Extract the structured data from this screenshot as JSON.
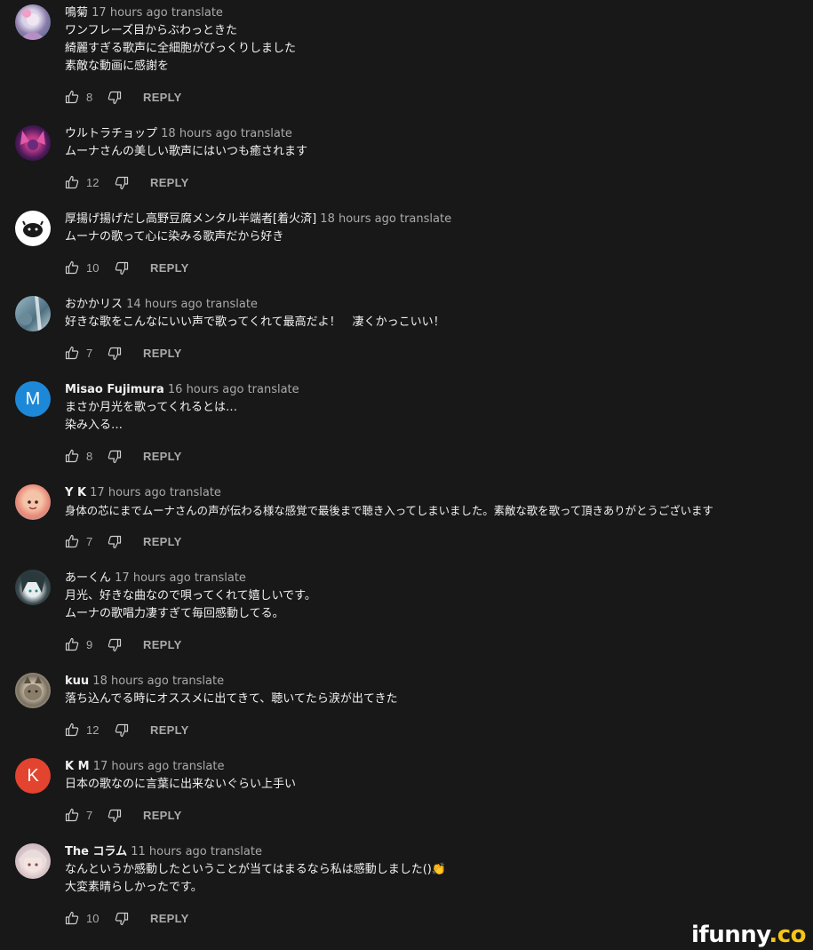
{
  "comments": [
    {
      "author": "鳴菊",
      "bold": false,
      "time": "17 hours ago",
      "translate": "translate",
      "lines": [
        "ワンフレーズ目からぶわっときた",
        "綺麗すぎる歌声に全細胞がびっくりしました",
        "素敵な動画に感謝を"
      ],
      "likes": "8",
      "reply": "REPLY"
    },
    {
      "author": "ウルトラチョップ",
      "bold": false,
      "time": "18 hours ago",
      "translate": "translate",
      "lines": [
        "ムーナさんの美しい歌声にはいつも癒されます"
      ],
      "likes": "12",
      "reply": "REPLY"
    },
    {
      "author": "厚揚げ揚げだし高野豆腐メンタル半端者[着火済]",
      "bold": false,
      "time": "18 hours ago",
      "translate": "translate",
      "lines": [
        "ムーナの歌って心に染みる歌声だから好き"
      ],
      "likes": "10",
      "reply": "REPLY"
    },
    {
      "author": "おかかリス",
      "bold": false,
      "time": "14 hours ago",
      "translate": "translate",
      "lines": [
        "好きな歌をこんなにいい声で歌ってくれて最高だよ！　凄くかっこいい！"
      ],
      "likes": "7",
      "reply": "REPLY"
    },
    {
      "author": "Misao Fujimura",
      "bold": true,
      "time": "16 hours ago",
      "translate": "translate",
      "lines": [
        "まさか月光を歌ってくれるとは…",
        "染み入る…"
      ],
      "likes": "8",
      "reply": "REPLY",
      "avatar_letter": "M"
    },
    {
      "author": "Y K",
      "bold": true,
      "time": "17 hours ago",
      "translate": "translate",
      "lines": [
        "身体の芯にまでムーナさんの声が伝わる様な感覚で最後まで聴き入ってしまいました。素敵な歌を歌って頂きありがとうございます"
      ],
      "likes": "7",
      "reply": "REPLY"
    },
    {
      "author": "あーくん",
      "bold": false,
      "time": "17 hours ago",
      "translate": "translate",
      "lines": [
        "月光、好きな曲なので唄ってくれて嬉しいです。",
        "ムーナの歌唱力凄すぎて毎回感動してる。"
      ],
      "likes": "9",
      "reply": "REPLY"
    },
    {
      "author": "kuu",
      "bold": true,
      "time": "18 hours ago",
      "translate": "translate",
      "lines": [
        "落ち込んでる時にオススメに出てきて、聴いてたら涙が出てきた"
      ],
      "likes": "12",
      "reply": "REPLY"
    },
    {
      "author": "K M",
      "bold": true,
      "time": "17 hours ago",
      "translate": "translate",
      "lines": [
        "日本の歌なのに言葉に出来ないぐらい上手い"
      ],
      "likes": "7",
      "reply": "REPLY",
      "avatar_letter": "K"
    },
    {
      "author": "The コラム",
      "bold": true,
      "time": "11 hours ago",
      "translate": "translate",
      "lines": [
        "なんというか感動したということが当てはまるなら私は感動しました()👏",
        "大変素晴らしかったです。"
      ],
      "likes": "10",
      "reply": "REPLY"
    }
  ],
  "watermark": {
    "main": "ifunny",
    "suffix": ".co"
  },
  "colors": {
    "background": "#181818",
    "text": "#f1f1f1",
    "muted": "#aaaaaa",
    "misao_avatar": "#1e88d8",
    "km_avatar": "#e2442f"
  }
}
